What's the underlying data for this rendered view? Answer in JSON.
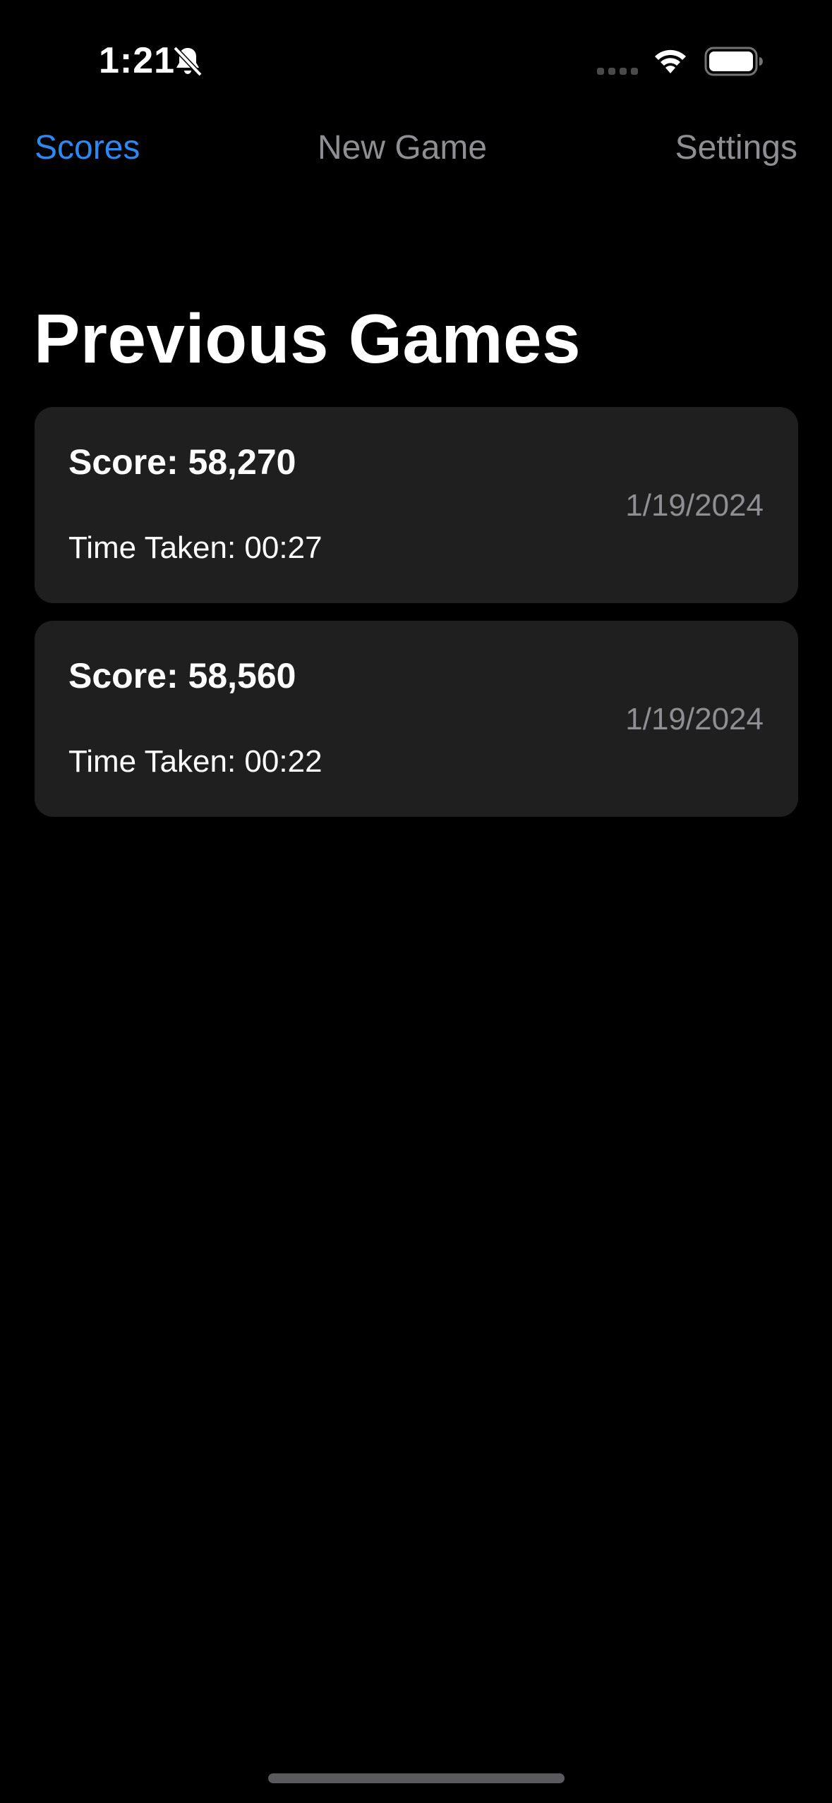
{
  "status_bar": {
    "time": "1:21",
    "icons": [
      "bell-slash-icon",
      "cellular-signal-icon",
      "wifi-icon",
      "battery-icon"
    ]
  },
  "tabs": [
    {
      "label": "Scores",
      "active": true
    },
    {
      "label": "New Game",
      "active": false
    },
    {
      "label": "Settings",
      "active": false
    }
  ],
  "page": {
    "title": "Previous Games"
  },
  "games": [
    {
      "score": "Score: 58,270",
      "time_taken": "Time Taken: 00:27",
      "date": "1/19/2024"
    },
    {
      "score": "Score: 58,560",
      "time_taken": "Time Taken: 00:22",
      "date": "1/19/2024"
    }
  ],
  "colors": {
    "background": "#000000",
    "card": "#1f1f1f",
    "accent": "#2f87f0",
    "secondary_text": "#8e8e93"
  }
}
